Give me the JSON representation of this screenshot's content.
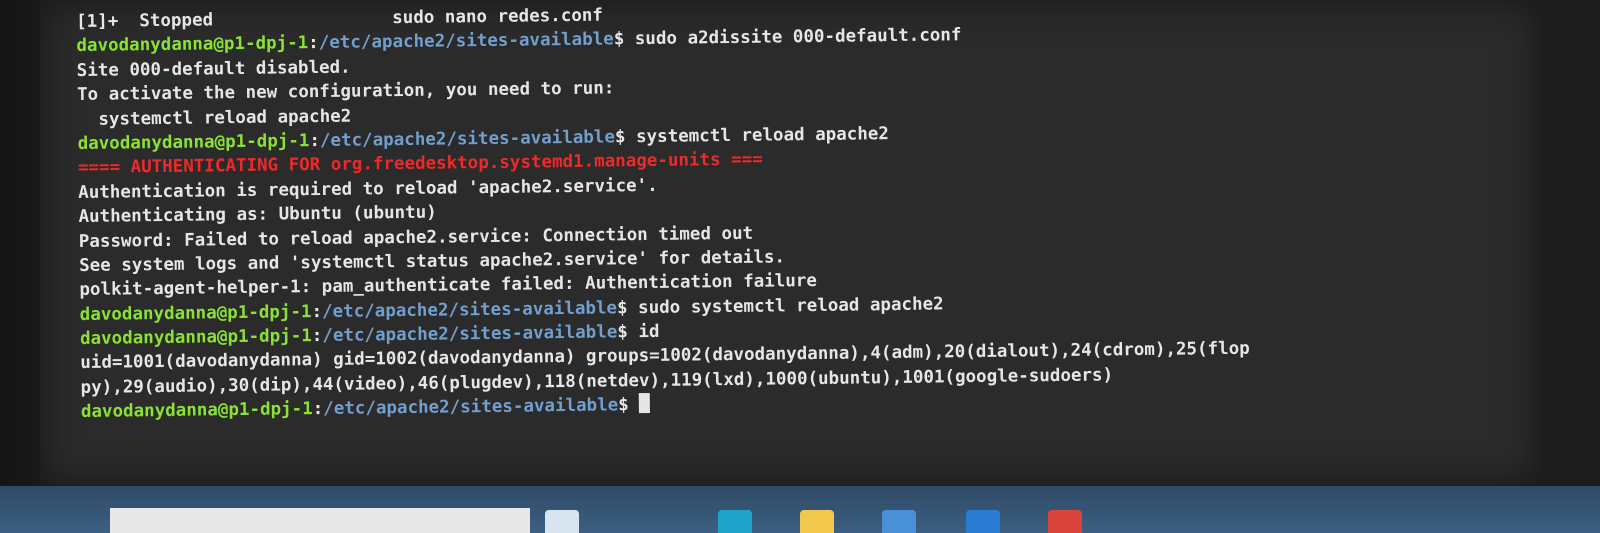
{
  "terminal": {
    "prompt": {
      "user_host": "davodanydanna@p1-dpj-1",
      "colon": ":",
      "path": "/etc/apache2/sites-available",
      "dollar": "$ "
    },
    "lines": [
      {
        "type": "out",
        "text": "[1]+  Stopped                 sudo nano redes.conf"
      },
      {
        "type": "cmd",
        "text": "sudo a2dissite 000-default.conf"
      },
      {
        "type": "out",
        "text": "Site 000-default disabled."
      },
      {
        "type": "out",
        "text": "To activate the new configuration, you need to run:"
      },
      {
        "type": "out",
        "text": "  systemctl reload apache2"
      },
      {
        "type": "cmd",
        "text": "systemctl reload apache2"
      },
      {
        "type": "auth",
        "text": "==== AUTHENTICATING FOR org.freedesktop.systemd1.manage-units ==="
      },
      {
        "type": "out",
        "text": "Authentication is required to reload 'apache2.service'."
      },
      {
        "type": "out",
        "text": "Authenticating as: Ubuntu (ubuntu)"
      },
      {
        "type": "out",
        "text": "Password: Failed to reload apache2.service: Connection timed out"
      },
      {
        "type": "out",
        "text": "See system logs and 'systemctl status apache2.service' for details."
      },
      {
        "type": "out",
        "text": "polkit-agent-helper-1: pam_authenticate failed: Authentication failure"
      },
      {
        "type": "cmd",
        "text": "sudo systemctl reload apache2"
      },
      {
        "type": "cmd",
        "text": "id"
      },
      {
        "type": "out",
        "text": "uid=1001(davodanydanna) gid=1002(davodanydanna) groups=1002(davodanydanna),4(adm),20(dialout),24(cdrom),25(flop"
      },
      {
        "type": "out",
        "text": "py),29(audio),30(dip),44(video),46(plugdev),118(netdev),119(lxd),1000(ubuntu),1001(google-sudoers)"
      },
      {
        "type": "cmd",
        "text": "",
        "cursor": true
      }
    ]
  },
  "colors": {
    "prompt_user": "#8ae234",
    "prompt_path": "#729fcf",
    "auth_header": "#ef2929",
    "output_text": "#e6e6e6",
    "terminal_bg": "#2b2b2b",
    "taskbar_bg": "#3c5f82"
  },
  "taskbar": {
    "icons": [
      {
        "name": "task-view-icon",
        "color": "#d8e4f0"
      },
      {
        "name": "edge-browser-icon",
        "color": "#1fa3c9"
      },
      {
        "name": "file-explorer-icon",
        "color": "#f2c94c"
      },
      {
        "name": "store-icon",
        "color": "#4a90d9"
      },
      {
        "name": "mail-icon",
        "color": "#2a7bd4"
      },
      {
        "name": "chrome-icon",
        "color": "#d9453b"
      }
    ]
  }
}
